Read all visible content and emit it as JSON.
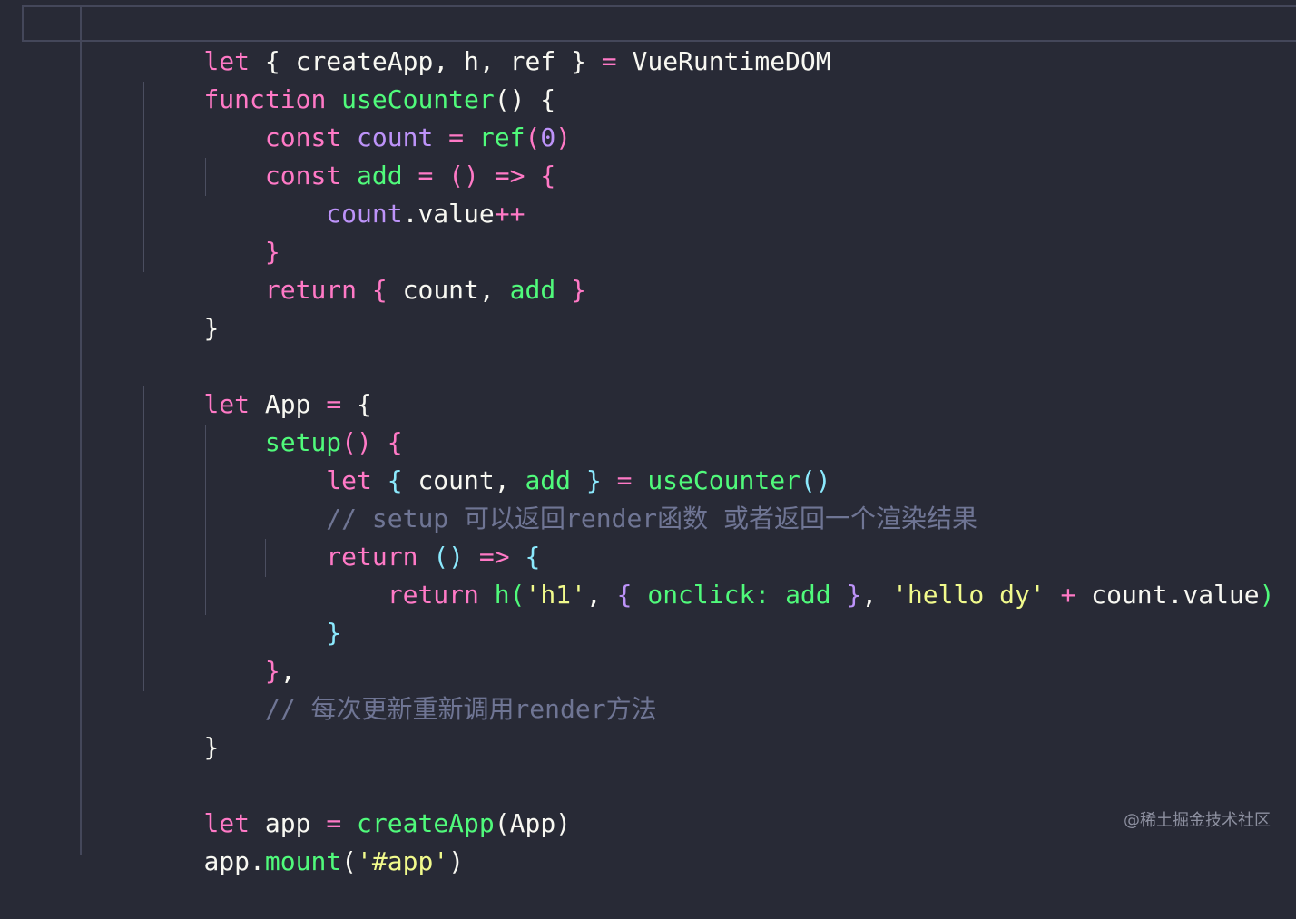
{
  "code": {
    "l1": [
      "let",
      " { ",
      "createApp",
      ", ",
      "h",
      ", ",
      "ref",
      " } ",
      "=",
      " VueRuntimeDOM"
    ],
    "l2": [
      "function",
      " ",
      "useCounter",
      "() {"
    ],
    "l3": [
      "    ",
      "const",
      " ",
      "count",
      " = ",
      "ref",
      "(",
      "0",
      ")"
    ],
    "l4": [
      "    ",
      "const",
      " ",
      "add",
      " = ",
      "()",
      " => ",
      "{"
    ],
    "l5": [
      "        ",
      "count",
      ".value",
      "++"
    ],
    "l6": [
      "    ",
      "}"
    ],
    "l7": [
      "    ",
      "return",
      " ",
      "{",
      " count, ",
      "add",
      " ",
      "}"
    ],
    "l8": [
      "}"
    ],
    "l10": [
      "let",
      " App ",
      "=",
      " {"
    ],
    "l11": [
      "    ",
      "setup",
      "()",
      " {"
    ],
    "l12": [
      "        ",
      "let",
      " ",
      "{",
      " count, ",
      "add",
      " ",
      "}",
      " = ",
      "useCounter",
      "()"
    ],
    "l13": [
      "        ",
      "// setup 可以返回render函数 或者返回一个渲染结果"
    ],
    "l14": [
      "        ",
      "return",
      " ",
      "()",
      " ",
      "=>",
      " ",
      "{"
    ],
    "l15": [
      "            ",
      "return",
      " ",
      "h(",
      "'h1'",
      ", ",
      "{",
      " ",
      "onclick:",
      " ",
      "add",
      " ",
      "}",
      ", ",
      "'hello dy'",
      " ",
      "+",
      " count.value",
      ")"
    ],
    "l16": [
      "        ",
      "}"
    ],
    "l17": [
      "    ",
      "}",
      ","
    ],
    "l18": [
      "    ",
      "// 每次更新重新调用render方法"
    ],
    "l19": [
      "}"
    ],
    "l21": [
      "let",
      " app ",
      "=",
      " ",
      "createApp",
      "(App)"
    ],
    "l22": [
      "app.",
      "mount",
      "(",
      "'#app'",
      ")"
    ]
  },
  "watermark": "@稀土掘金技术社区"
}
